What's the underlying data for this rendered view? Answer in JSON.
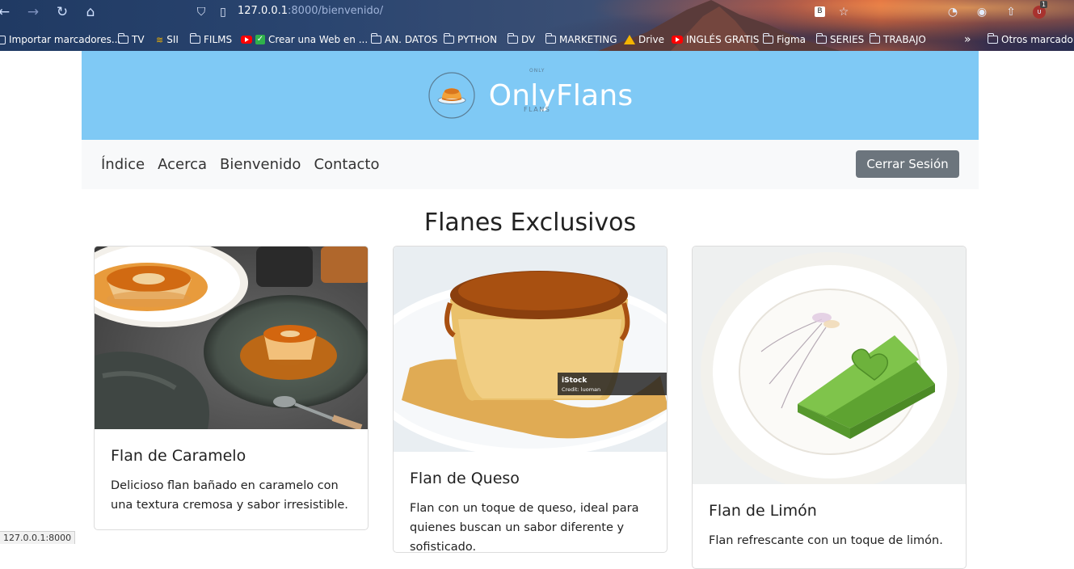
{
  "browser": {
    "url_host": "127.0.0.1",
    "url_path": ":8000/bienvenido/",
    "bookmarks": [
      {
        "label": "Importar marcadores...",
        "icon": "import-icon"
      },
      {
        "label": "TV",
        "icon": "folder-icon"
      },
      {
        "label": "SII",
        "icon": "sii-icon"
      },
      {
        "label": "FILMS",
        "icon": "folder-icon"
      },
      {
        "label": "Crear una Web en ...",
        "icon": "youtube-icon"
      },
      {
        "label": "AN. DATOS",
        "icon": "folder-icon"
      },
      {
        "label": "PYTHON",
        "icon": "folder-icon"
      },
      {
        "label": "DV",
        "icon": "folder-icon"
      },
      {
        "label": "MARKETING",
        "icon": "folder-icon"
      },
      {
        "label": "Drive",
        "icon": "drive-icon"
      },
      {
        "label": "INGLÉS GRATIS",
        "icon": "youtube-icon"
      },
      {
        "label": "Figma",
        "icon": "folder-icon"
      },
      {
        "label": "SERIES",
        "icon": "folder-icon"
      },
      {
        "label": "TRABAJO",
        "icon": "folder-icon"
      },
      {
        "label": "Otros marcadores",
        "icon": "folder-icon"
      }
    ],
    "extension_badge": "1",
    "status_url": "127.0.0.1:8000"
  },
  "site": {
    "title": "OnlyFlans",
    "logo_top": "ONLY",
    "logo_bottom": "FLANS",
    "brand_color": "#7fc9f5"
  },
  "nav": {
    "links": [
      "Índice",
      "Acerca",
      "Bienvenido",
      "Contacto"
    ],
    "logout_label": "Cerrar Sesión"
  },
  "main": {
    "heading": "Flanes Exclusivos",
    "cards": [
      {
        "title": "Flan de Caramelo",
        "description": "Delicioso flan bañado en caramelo con una textura cremosa y sabor irresistible."
      },
      {
        "title": "Flan de Queso",
        "description": "Flan con un toque de queso, ideal para quienes buscan un sabor diferente y sofisticado.",
        "watermark_brand": "iStock",
        "watermark_credit": "Credit: luoman"
      },
      {
        "title": "Flan de Limón",
        "description": "Flan refrescante con un toque de limón."
      }
    ]
  }
}
